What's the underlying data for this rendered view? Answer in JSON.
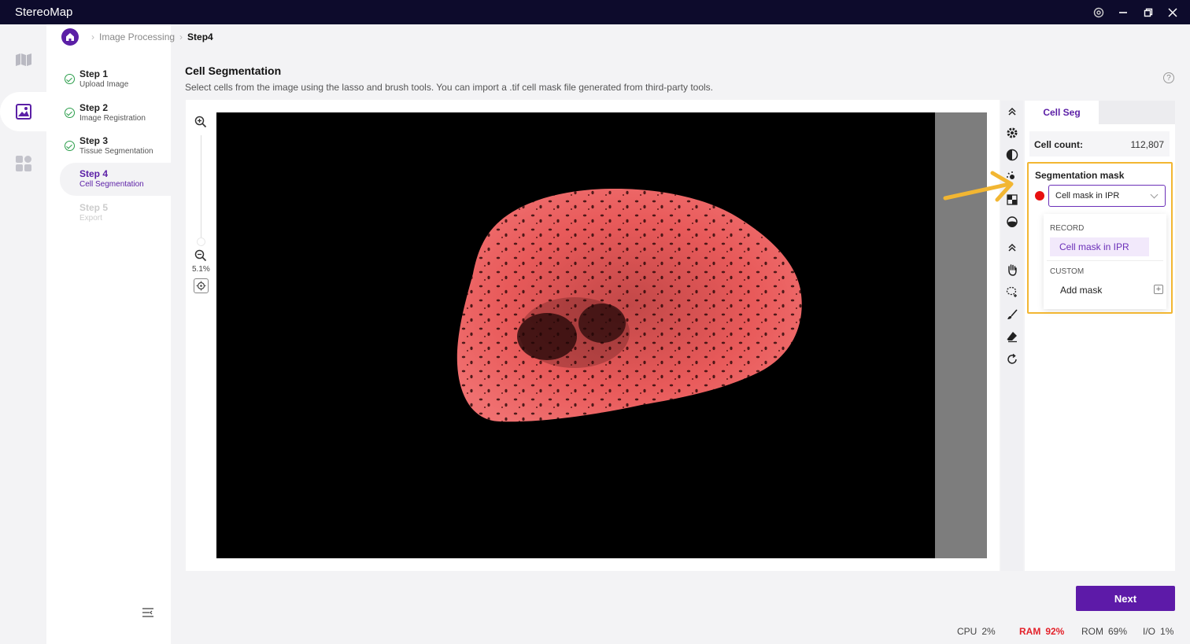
{
  "window": {
    "title": "StereoMap"
  },
  "breadcrumb": {
    "parent": "Image Processing",
    "current": "Step4"
  },
  "steps": [
    {
      "title": "Step 1",
      "subtitle": "Upload Image",
      "state": "done"
    },
    {
      "title": "Step 2",
      "subtitle": "Image Registration",
      "state": "done"
    },
    {
      "title": "Step 3",
      "subtitle": "Tissue Segmentation",
      "state": "done"
    },
    {
      "title": "Step 4",
      "subtitle": "Cell Segmentation",
      "state": "active"
    },
    {
      "title": "Step 5",
      "subtitle": "Export",
      "state": "disabled"
    }
  ],
  "main": {
    "title": "Cell Segmentation",
    "description": "Select cells from the image using the lasso and brush tools. You can import a .tif cell mask file generated from third-party tools."
  },
  "viewer": {
    "zoom_level": "5.1%"
  },
  "panel": {
    "tab_label": "Cell Seg",
    "cell_count_label": "Cell count:",
    "cell_count_value": "112,807",
    "seg_mask_label": "Segmentation mask",
    "seg_mask_selected": "Cell mask in IPR",
    "mask_color": "#e81010",
    "dropdown": {
      "record_header": "RECORD",
      "record_option": "Cell mask in IPR",
      "custom_header": "CUSTOM",
      "add_mask_label": "Add mask"
    }
  },
  "footer": {
    "next_label": "Next",
    "cpu_label": "CPU",
    "cpu_value": "2%",
    "ram_label": "RAM",
    "ram_value": "92%",
    "rom_label": "ROM",
    "rom_value": "69%",
    "io_label": "I/O",
    "io_value": "1%"
  },
  "colors": {
    "accent": "#5b1fa6",
    "highlight": "#f2b632",
    "tissue": "#e85a5a",
    "warning": "#e3212a"
  }
}
